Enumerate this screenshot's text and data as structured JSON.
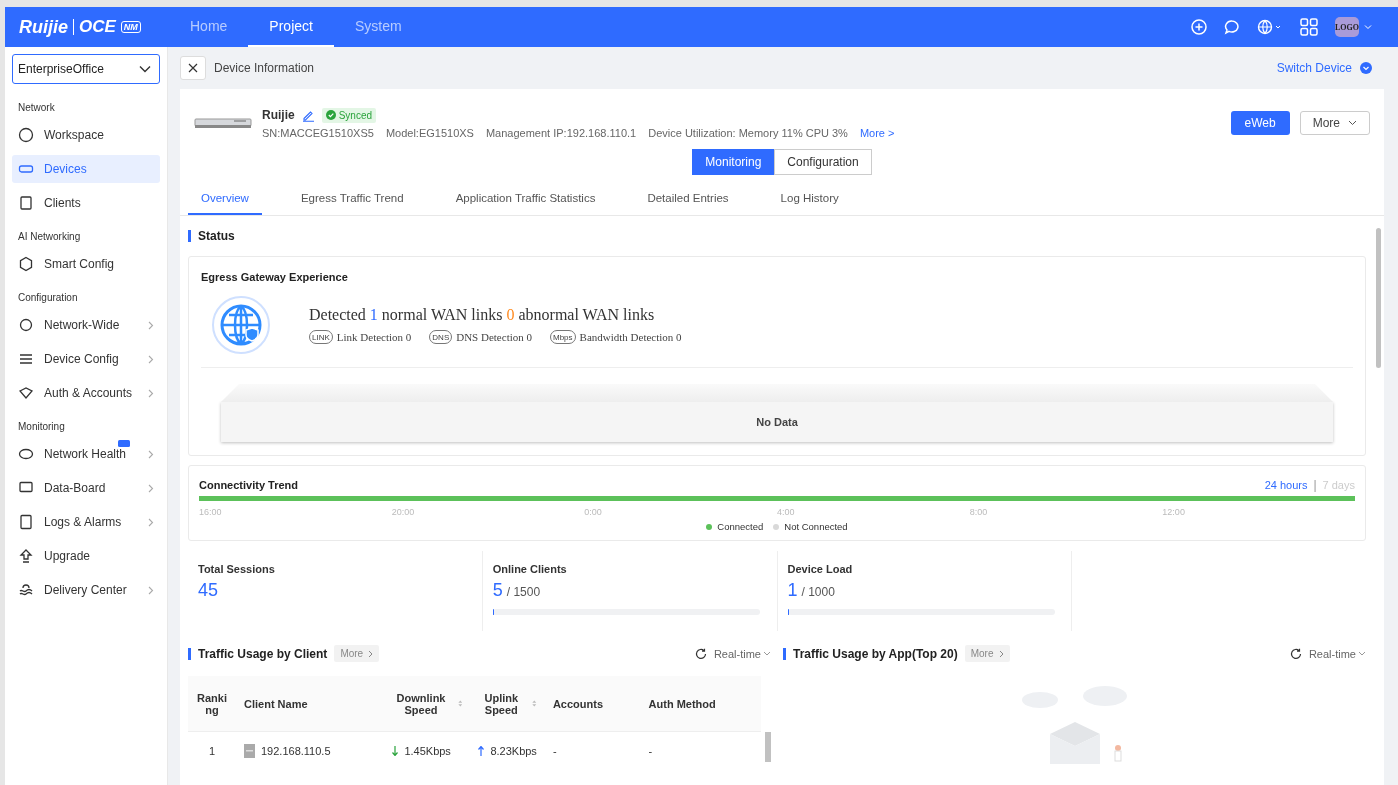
{
  "header": {
    "logo": "Ruijie",
    "product": "OCE",
    "product_badge": "NM",
    "avatar": "LOGO",
    "nav": [
      {
        "label": "Home",
        "selected": false
      },
      {
        "label": "Project",
        "selected": true
      },
      {
        "label": "System",
        "selected": false
      }
    ]
  },
  "sidebar": {
    "project": "EnterpriseOffice",
    "groups": [
      {
        "heading": "Network",
        "items": [
          {
            "label": "Workspace",
            "selected": false,
            "has_submenu": false,
            "beta": false
          },
          {
            "label": "Devices",
            "selected": true,
            "has_submenu": false,
            "beta": false
          },
          {
            "label": "Clients",
            "selected": false,
            "has_submenu": false,
            "beta": false
          }
        ]
      },
      {
        "heading": "AI Networking",
        "items": [
          {
            "label": "Smart Config",
            "selected": false,
            "has_submenu": false,
            "beta": false
          }
        ]
      },
      {
        "heading": "Configuration",
        "items": [
          {
            "label": "Network-Wide",
            "selected": false,
            "has_submenu": true,
            "beta": false
          },
          {
            "label": "Device Config",
            "selected": false,
            "has_submenu": true,
            "beta": false
          },
          {
            "label": "Auth & Accounts",
            "selected": false,
            "has_submenu": true,
            "beta": false
          }
        ]
      },
      {
        "heading": "Monitoring",
        "items": [
          {
            "label": "Network Health",
            "selected": false,
            "has_submenu": true,
            "beta": true
          },
          {
            "label": "Data-Board",
            "selected": false,
            "has_submenu": true,
            "beta": false
          },
          {
            "label": "Logs & Alarms",
            "selected": false,
            "has_submenu": true,
            "beta": false
          },
          {
            "label": "Upgrade",
            "selected": false,
            "has_submenu": false,
            "beta": false
          },
          {
            "label": "Delivery Center",
            "selected": false,
            "has_submenu": true,
            "beta": false
          }
        ]
      }
    ]
  },
  "breadcrumb": {
    "title": "Device Information",
    "switch_device": "Switch Device"
  },
  "device": {
    "name": "Ruijie",
    "status": "Synced",
    "sn": "SN:MACCEG1510XS5",
    "model": "Model:EG1510XS",
    "ip": "Management IP:192.168.110.1",
    "utilization": "Device Utilization: Memory 11% CPU 3%",
    "more_link": "More >",
    "eweb": "eWeb",
    "more": "More"
  },
  "mode_tabs": [
    {
      "label": "Monitoring",
      "selected": true
    },
    {
      "label": "Configuration",
      "selected": false
    }
  ],
  "tabs": [
    {
      "label": "Overview",
      "selected": true
    },
    {
      "label": "Egress Traffic Trend",
      "selected": false
    },
    {
      "label": "Application Traffic Statistics",
      "selected": false
    },
    {
      "label": "Detailed Entries",
      "selected": false
    },
    {
      "label": "Log History",
      "selected": false
    }
  ],
  "status": {
    "title": "Status",
    "egress": {
      "title": "Egress Gateway Experience",
      "detected": "Detected",
      "normal_count": "1",
      "normal_label": "normal WAN links",
      "abnormal_count": "0",
      "abnormal_label": "abnormal WAN links",
      "detections": [
        {
          "icon_label": "LINK",
          "label": "Link Detection 0"
        },
        {
          "icon_label": "DNS",
          "label": "DNS Detection 0"
        },
        {
          "icon_label": "Mbps",
          "label": "Bandwidth Detection 0"
        }
      ],
      "empty": "No Data"
    }
  },
  "connectivity": {
    "title": "Connectivity Trend",
    "range_separator": "|",
    "ranges": [
      {
        "label": "24 hours",
        "selected": true
      },
      {
        "label": "7 days",
        "selected": false
      }
    ],
    "times": [
      "16:00",
      "20:00",
      "0:00",
      "4:00",
      "8:00",
      "12:00"
    ],
    "legend": [
      {
        "label": "Connected",
        "color": "#5cc15a"
      },
      {
        "label": "Not Connected",
        "color": "#d9d9d9"
      }
    ]
  },
  "stats": [
    {
      "kind": "count",
      "label": "Total Sessions",
      "value": "45"
    },
    {
      "kind": "quota",
      "label": "Online Clients",
      "value": "5",
      "total": "/ 1500",
      "level": 0.004
    },
    {
      "kind": "quota",
      "label": "Device Load",
      "value": "1",
      "total": "/ 1000",
      "level": 0.002
    }
  ],
  "traffic_client": {
    "title": "Traffic Usage by Client",
    "more": "More",
    "range": "Real-time",
    "columns": [
      {
        "label": "Ranking",
        "sortable": false
      },
      {
        "label": "Client Name",
        "sortable": false
      },
      {
        "label": "Downlink Speed",
        "sortable": true
      },
      {
        "label": "Uplink Speed",
        "sortable": true
      },
      {
        "label": "Accounts",
        "sortable": false
      },
      {
        "label": "Auth Method",
        "sortable": false
      }
    ],
    "rows": [
      {
        "rank": "1",
        "name": "192.168.110.5",
        "down": "1.45Kbps",
        "up": "8.23Kbps",
        "accounts": "-",
        "auth": "-"
      }
    ]
  },
  "traffic_app": {
    "title": "Traffic Usage by App(Top 20)",
    "more": "More",
    "range": "Real-time"
  }
}
